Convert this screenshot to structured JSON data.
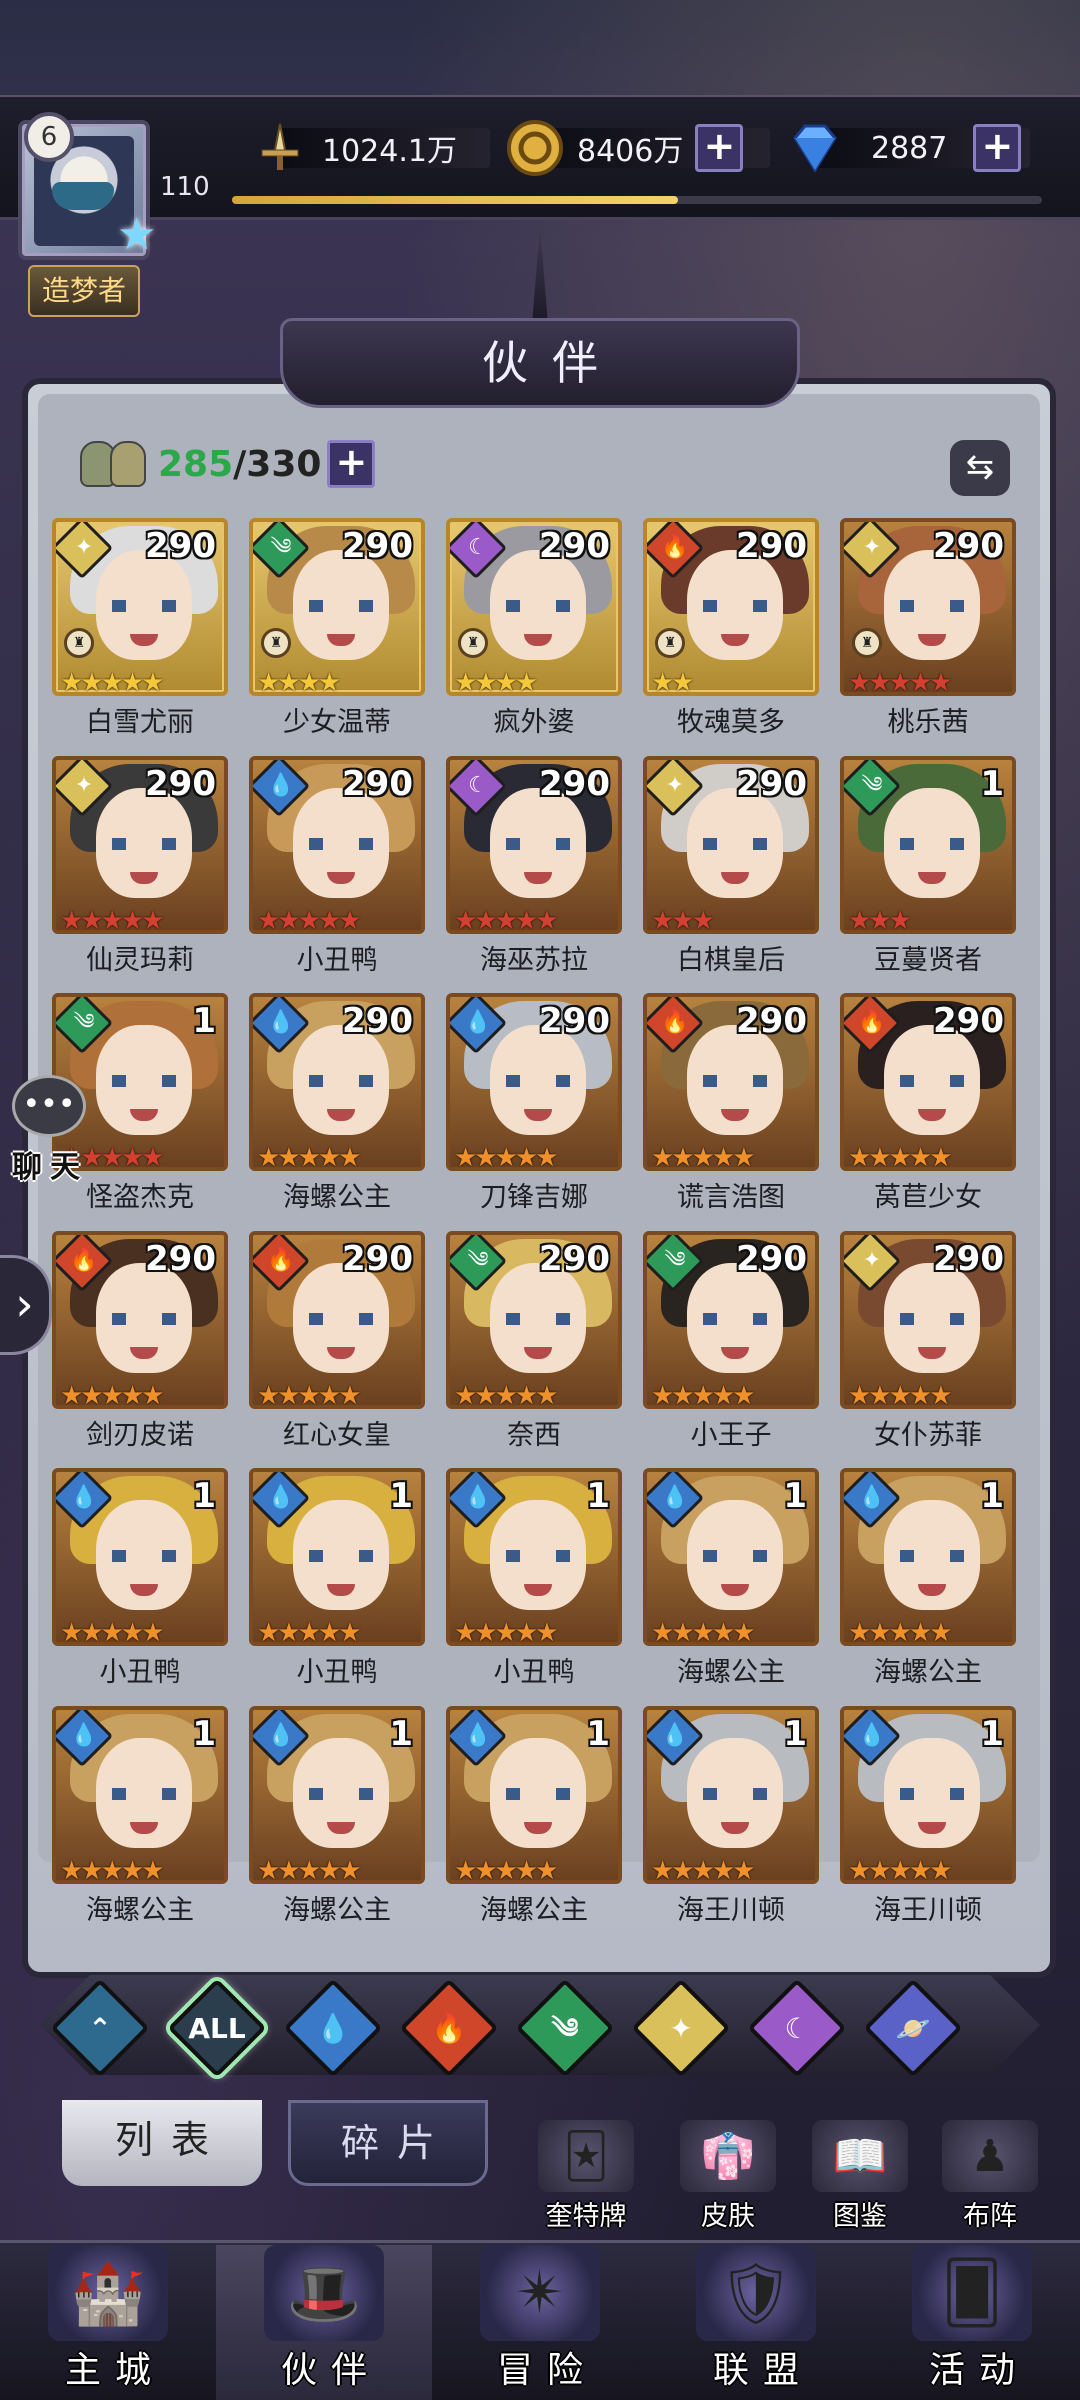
{
  "player": {
    "level": "6",
    "account_level": "110",
    "title": "造梦者",
    "exp_progress": 0.55
  },
  "resources": [
    {
      "name": "power",
      "icon": "sword-icon",
      "value": "1024.1万",
      "has_plus": false
    },
    {
      "name": "gold",
      "icon": "gold-coin-icon",
      "value": "8406万",
      "has_plus": true
    },
    {
      "name": "diamond",
      "icon": "diamond-icon",
      "value": "2887",
      "has_plus": true
    }
  ],
  "header": {
    "title": "伙伴"
  },
  "roster": {
    "owned": "285",
    "capacity": "/330"
  },
  "elements": {
    "water": "#3a78c8",
    "wind": "#2e9a5a",
    "fire": "#d0462a",
    "light": "#d9c05a",
    "arcane": "#9a5ac8",
    "all": "#2a3e4e",
    "base": "#2e6a8e",
    "planet": "#5a62c8"
  },
  "partners": [
    {
      "name": "白雪尤丽",
      "level": "290",
      "element": "light",
      "stars": 5,
      "star_color": "gold",
      "throne": true,
      "hair": "#dcdcdc"
    },
    {
      "name": "少女温蒂",
      "level": "290",
      "element": "wind",
      "stars": 4,
      "star_color": "gold",
      "throne": true,
      "hair": "#b88a4a"
    },
    {
      "name": "疯外婆",
      "level": "290",
      "element": "arcane",
      "stars": 4,
      "star_color": "gold",
      "throne": true,
      "hair": "#9a9aa0"
    },
    {
      "name": "牧魂莫多",
      "level": "290",
      "element": "fire",
      "stars": 2,
      "star_color": "gold",
      "throne": true,
      "hair": "#6a3a2a"
    },
    {
      "name": "桃乐茜",
      "level": "290",
      "element": "light",
      "stars": 5,
      "star_color": "red",
      "throne": true,
      "hair": "#a8643a"
    },
    {
      "name": "仙灵玛莉",
      "level": "290",
      "element": "light",
      "stars": 5,
      "star_color": "red",
      "throne": false,
      "hair": "#3a3a3a"
    },
    {
      "name": "小丑鸭",
      "level": "290",
      "element": "water",
      "stars": 5,
      "star_color": "red",
      "throne": false,
      "hair": "#c89a5a"
    },
    {
      "name": "海巫苏拉",
      "level": "290",
      "element": "arcane",
      "stars": 5,
      "star_color": "red",
      "throne": false,
      "hair": "#2a2a34"
    },
    {
      "name": "白棋皇后",
      "level": "290",
      "element": "light",
      "stars": 3,
      "star_color": "red",
      "throne": false,
      "hair": "#d0ccc8"
    },
    {
      "name": "豆蔓贤者",
      "level": "1",
      "element": "wind",
      "stars": 3,
      "star_color": "red",
      "throne": false,
      "hair": "#4a6a3a"
    },
    {
      "name": "怪盗杰克",
      "level": "1",
      "element": "wind",
      "stars": 5,
      "star_color": "red",
      "throne": false,
      "hair": "#b0703a"
    },
    {
      "name": "海螺公主",
      "level": "290",
      "element": "water",
      "stars": 5,
      "star_color": "orange",
      "throne": false,
      "hair": "#c8a060"
    },
    {
      "name": "刀锋吉娜",
      "level": "290",
      "element": "water",
      "stars": 5,
      "star_color": "orange",
      "throne": false,
      "hair": "#b8bcc4"
    },
    {
      "name": "谎言浩图",
      "level": "290",
      "element": "fire",
      "stars": 5,
      "star_color": "orange",
      "throne": false,
      "hair": "#8a6a3a"
    },
    {
      "name": "莴苣少女",
      "level": "290",
      "element": "fire",
      "stars": 5,
      "star_color": "orange",
      "throne": false,
      "hair": "#2a2020"
    },
    {
      "name": "剑刃皮诺",
      "level": "290",
      "element": "fire",
      "stars": 5,
      "star_color": "orange",
      "throne": false,
      "hair": "#4a3020"
    },
    {
      "name": "红心女皇",
      "level": "290",
      "element": "fire",
      "stars": 5,
      "star_color": "orange",
      "throne": false,
      "hair": "#b07a3a"
    },
    {
      "name": "奈西",
      "level": "290",
      "element": "wind",
      "stars": 5,
      "star_color": "orange",
      "throne": false,
      "hair": "#d8b860"
    },
    {
      "name": "小王子",
      "level": "290",
      "element": "wind",
      "stars": 5,
      "star_color": "orange",
      "throne": false,
      "hair": "#2a2420"
    },
    {
      "name": "女仆苏菲",
      "level": "290",
      "element": "light",
      "stars": 5,
      "star_color": "orange",
      "throne": false,
      "hair": "#7a4a30"
    },
    {
      "name": "小丑鸭",
      "level": "1",
      "element": "water",
      "stars": 5,
      "star_color": "orange",
      "throne": false,
      "hair": "#d8b040"
    },
    {
      "name": "小丑鸭",
      "level": "1",
      "element": "water",
      "stars": 5,
      "star_color": "orange",
      "throne": false,
      "hair": "#d8b040"
    },
    {
      "name": "小丑鸭",
      "level": "1",
      "element": "water",
      "stars": 5,
      "star_color": "orange",
      "throne": false,
      "hair": "#d8b040"
    },
    {
      "name": "海螺公主",
      "level": "1",
      "element": "water",
      "stars": 5,
      "star_color": "orange",
      "throne": false,
      "hair": "#c8a060"
    },
    {
      "name": "海螺公主",
      "level": "1",
      "element": "water",
      "stars": 5,
      "star_color": "orange",
      "throne": false,
      "hair": "#c8a060"
    },
    {
      "name": "海螺公主",
      "level": "1",
      "element": "water",
      "stars": 5,
      "star_color": "orange",
      "throne": false,
      "hair": "#c8a060"
    },
    {
      "name": "海螺公主",
      "level": "1",
      "element": "water",
      "stars": 5,
      "star_color": "orange",
      "throne": false,
      "hair": "#c8a060"
    },
    {
      "name": "海螺公主",
      "level": "1",
      "element": "water",
      "stars": 5,
      "star_color": "orange",
      "throne": false,
      "hair": "#c8a060"
    },
    {
      "name": "海王川顿",
      "level": "1",
      "element": "water",
      "stars": 5,
      "star_color": "orange",
      "throne": false,
      "hair": "#b8bcc0"
    },
    {
      "name": "海王川顿",
      "level": "1",
      "element": "water",
      "stars": 5,
      "star_color": "orange",
      "throne": false,
      "hair": "#b8bcc0"
    }
  ],
  "filters": [
    {
      "key": "base",
      "glyph": "⌃",
      "icon": "base-filter-icon"
    },
    {
      "key": "all",
      "glyph": "ALL",
      "icon": "all-filter-icon",
      "active": true
    },
    {
      "key": "water",
      "glyph": "💧",
      "icon": "water-filter-icon"
    },
    {
      "key": "fire",
      "glyph": "🔥",
      "icon": "fire-filter-icon"
    },
    {
      "key": "wind",
      "glyph": "༄",
      "icon": "wind-filter-icon"
    },
    {
      "key": "light",
      "glyph": "✦",
      "icon": "light-filter-icon"
    },
    {
      "key": "arcane",
      "glyph": "☾",
      "icon": "arcane-filter-icon"
    },
    {
      "key": "planet",
      "glyph": "🪐",
      "icon": "planet-filter-icon"
    }
  ],
  "subtabs": {
    "list": "列表",
    "fragments": "碎片"
  },
  "shortcuts": [
    {
      "label": "奎特牌",
      "icon": "card-icon",
      "glyph": "🃏"
    },
    {
      "label": "皮肤",
      "icon": "skin-icon",
      "glyph": "👘"
    },
    {
      "label": "图鉴",
      "icon": "codex-icon",
      "glyph": "📖"
    },
    {
      "label": "布阵",
      "icon": "formation-icon",
      "glyph": "♟"
    }
  ],
  "chat": {
    "label": "聊天"
  },
  "nav": [
    {
      "label": "主城",
      "icon": "castle-icon",
      "glyph": "🏰",
      "active": false
    },
    {
      "label": "伙伴",
      "icon": "partner-hat-icon",
      "glyph": "🎩",
      "active": true
    },
    {
      "label": "冒险",
      "icon": "adventure-portal-icon",
      "glyph": "✴",
      "active": false
    },
    {
      "label": "联盟",
      "icon": "alliance-shield-icon",
      "glyph": "🛡",
      "active": false
    },
    {
      "label": "活动",
      "icon": "event-cards-icon",
      "glyph": "🂠",
      "active": false
    }
  ]
}
